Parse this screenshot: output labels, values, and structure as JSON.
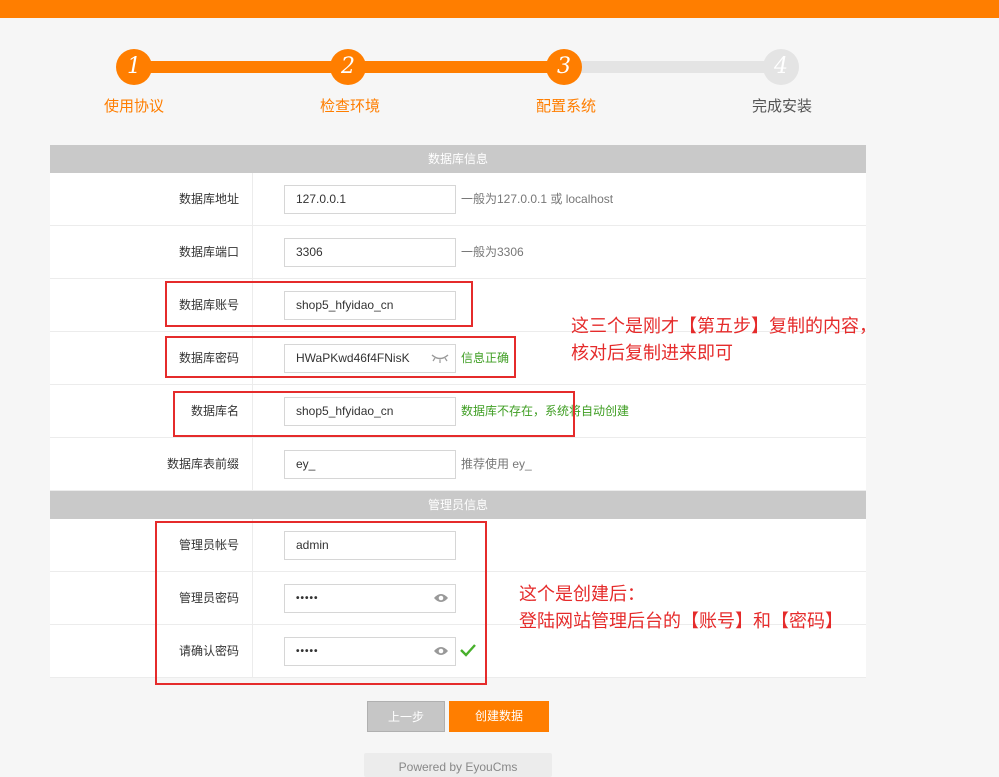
{
  "steps": [
    {
      "number": "1",
      "label": "使用协议"
    },
    {
      "number": "2",
      "label": "检查环境"
    },
    {
      "number": "3",
      "label": "配置系统"
    },
    {
      "number": "4",
      "label": "完成安装"
    }
  ],
  "db_section": {
    "title": "数据库信息",
    "host": {
      "label": "数据库地址",
      "value": "127.0.0.1",
      "hint": "一般为127.0.0.1 或 localhost"
    },
    "port": {
      "label": "数据库端口",
      "value": "3306",
      "hint": "一般为3306"
    },
    "user": {
      "label": "数据库账号",
      "value": "shop5_hfyidao_cn"
    },
    "password": {
      "label": "数据库密码",
      "value": "HWaPKwd46f4FNisK",
      "hint": "信息正确"
    },
    "name": {
      "label": "数据库名",
      "value": "shop5_hfyidao_cn",
      "hint": "数据库不存在，系统将自动创建"
    },
    "prefix": {
      "label": "数据库表前缀",
      "value": "ey_",
      "hint": "推荐使用 ey_"
    }
  },
  "admin_section": {
    "title": "管理员信息",
    "account": {
      "label": "管理员帐号",
      "value": "admin"
    },
    "password": {
      "label": "管理员密码",
      "value": "•••••"
    },
    "confirm": {
      "label": "请确认密码",
      "value": "•••••"
    }
  },
  "notes": {
    "db_note_line1": "这三个是刚才【第五步】复制的内容，",
    "db_note_line2": "核对后复制进来即可",
    "admin_note_line1": "这个是创建后：",
    "admin_note_line2": "登陆网站管理后台的【账号】和【密码】"
  },
  "buttons": {
    "prev": "上一步",
    "next": "创建数据"
  },
  "footer": {
    "powered": "Powered by EyouCms"
  },
  "icons": {
    "hide_password": "eye-closed-icon",
    "show_password": "eye-icon",
    "confirm_ok": "check-icon"
  },
  "colors": {
    "accent": "#ff7e00",
    "annotation": "#e52b2b",
    "success": "#3f9e23"
  }
}
